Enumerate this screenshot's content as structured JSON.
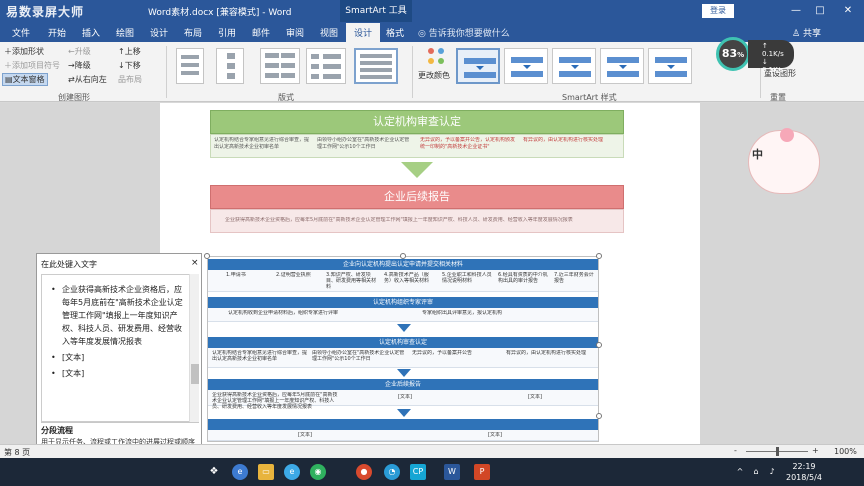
{
  "titlebar": {
    "watermark": "易数录屏大师",
    "doc_title": "Word素材.docx [兼容模式] - Word",
    "contextual_tab": "SmartArt 工具",
    "login": "登录",
    "minimize": "—",
    "restore": "□",
    "close": "✕"
  },
  "tabs": [
    "文件",
    "开始",
    "插入",
    "绘图",
    "设计",
    "布局",
    "引用",
    "邮件",
    "审阅",
    "视图",
    "设计",
    "格式"
  ],
  "tell_me": "告诉我你想要做什么",
  "share": "共享",
  "ribbon": {
    "create_graphic": {
      "add_shape": "添加形状",
      "add_bullet": "添加项目符号",
      "text_pane": "文本窗格",
      "promote": "升级",
      "demote": "降级",
      "right_to_left": "从右向左",
      "move_up": "上移",
      "move_down": "下移",
      "layout": "布局",
      "label": "创建图形"
    },
    "layouts_label": "版式",
    "change_colors": "更改颜色",
    "styles_label": "SmartArt 样式",
    "reset": "重设图形",
    "reset_label": "重置"
  },
  "speed": {
    "percent": "83",
    "unit": "%",
    "up": "0.1",
    "down": "0.1",
    "rate_unit": "K/s"
  },
  "document": {
    "block1": {
      "title": "认定机构审查认定",
      "cells": [
        "认定机构结合专家组意见进行综合审查，提出认定高新技术企业初审名单",
        "由领导小组办公室在\"高新技术企业认定管理工作网\"公示10个工作日",
        "无异议的，予以备案并公告，认定机构颁发统一印制的\"高新技术企业证书\"",
        "有异议的，由认定机构进行核实处理"
      ]
    },
    "block2": {
      "title": "企业后续报告",
      "text": "企业获得高新技术企业资格后，应每年5月底前在\"高新技术企业认定管理工作网\"填报上一年度知识产权、科技人员、研发费用、经营收入等年度发展情况报表"
    },
    "smartart": {
      "rows": [
        {
          "header": "企业向认定机构提出认定申请并提交相关材料",
          "cells": [
            "1.申请书",
            "2.证明营业执照",
            "3.知识产权、研发项目、研发费用等相关材料",
            "4.高新技术产品（服务）收入等相关材料",
            "5.企业职工和科技人员情况说明材料",
            "6.经具有资质的中介机构出具的审计报告",
            "7.近三年财务会计报告"
          ]
        },
        {
          "header": "认定机构组织专家评审",
          "cells": [
            "认定机构收到企业申请材料后，组织专家进行评审",
            "专家组织出具评审意见，报认定机构"
          ]
        },
        {
          "header": "认定机构审查认定",
          "cells": [
            "认定机构结合专家组意见进行综合审查，提出认定高新技术企业初审名单",
            "由领导小组办公室在\"高新技术企业认定管理工作网\"公示10个工作日",
            "无异议的，予以备案并公告",
            "有异议的，由认定机构进行核实处理"
          ]
        },
        {
          "header": "企业后续报告",
          "cells": [
            "企业获得高新技术企业资格后，应每年5月底前在\"高新技术企业认定管理工作网\"填报上一年度知识产权、科技人员、研发费用、经营收入等年度发展情况报表",
            "[文本]",
            "[文本]"
          ]
        },
        {
          "header": "",
          "cells": [
            "[文本]",
            "[文本]"
          ]
        }
      ]
    }
  },
  "text_pane": {
    "title": "在此处键入文字",
    "close": "×",
    "bullets": [
      "企业获得高新技术企业资格后，应每年5月底前在\"高新技术企业认定管理工作网\"填报上一年度知识产权、科技人员、研发费用、经营收入等年度发展情况报表",
      "[文本]",
      "[文本]"
    ],
    "help_title": "分段流程",
    "help_text": "用于显示任务、流程或工作流中的进展过程或顺序步骤。因为每一行都带有动态形状显示，所以强调每一行第二层文字。了解有关 SmartArt 图形的详细信息"
  },
  "mascot_badge": "中",
  "statusbar": {
    "page": "第 8 页",
    "zoom": "100%",
    "zoom_minus": "-",
    "zoom_plus": "+"
  },
  "taskbar": {
    "time": "22:19",
    "date": "2018/5/4"
  }
}
